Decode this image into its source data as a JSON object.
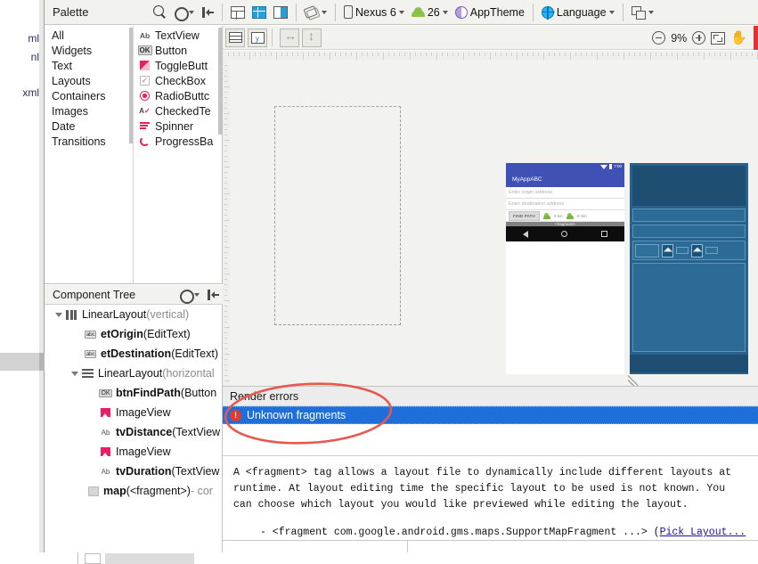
{
  "editor_tabs": [
    {
      "label": "ml"
    },
    {
      "label": "nl"
    },
    {
      "label": "xml"
    }
  ],
  "toolbar": {
    "palette_title": "Palette",
    "search_icon": "search-icon",
    "gear_icon": "gear-icon",
    "collapse_icon": "collapse-all-icon",
    "view_design_icon": "design-view-icon",
    "view_blueprint_icon": "blueprint-view-icon",
    "view_both_icon": "both-views-icon",
    "orientation_icon": "orientation-icon",
    "device_label": "Nexus 6",
    "api_label": "26",
    "theme_label": "AppTheme",
    "language_label": "Language",
    "layout_variant_icon": "layout-variants-icon"
  },
  "toolbar2": {
    "baseline_icon": "show-baselines-icon",
    "constraints_icon": "show-constraints-icon",
    "expand_horizontal_icon": "expand-horizontal-icon",
    "expand_vertical_icon": "expand-vertical-icon",
    "zoom_out_icon": "zoom-out-icon",
    "zoom_level": "9%",
    "zoom_in_icon": "zoom-in-icon",
    "zoom_fit_icon": "zoom-to-fit-icon",
    "pan_icon": "pan-hand-icon"
  },
  "palette": {
    "categories": [
      {
        "label": "All"
      },
      {
        "label": "Widgets"
      },
      {
        "label": "Text"
      },
      {
        "label": "Layouts"
      },
      {
        "label": "Containers"
      },
      {
        "label": "Images"
      },
      {
        "label": "Date"
      },
      {
        "label": "Transitions"
      }
    ],
    "items": [
      {
        "label": "TextView",
        "icon": "ab-text-icon"
      },
      {
        "label": "Button",
        "icon": "ok-button-icon"
      },
      {
        "label": "ToggleButt",
        "icon": "toggle-button-icon"
      },
      {
        "label": "CheckBox",
        "icon": "checkbox-icon"
      },
      {
        "label": "RadioButtc",
        "icon": "radio-button-icon"
      },
      {
        "label": "CheckedTe",
        "icon": "checked-textview-icon"
      },
      {
        "label": "Spinner",
        "icon": "spinner-icon"
      },
      {
        "label": "ProgressBa",
        "icon": "progressbar-icon"
      }
    ]
  },
  "component_tree": {
    "title": "Component Tree",
    "gear_icon": "gear-icon",
    "collapse_icon": "collapse-all-icon",
    "nodes": [
      {
        "icon": "linearlayout-vertical-icon",
        "name": "LinearLayout",
        "type": " (vertical)",
        "muted": true,
        "indent": 0,
        "expander": true
      },
      {
        "icon": "edittext-icon",
        "name": "etOrigin",
        "type": " (EditText)",
        "muted": false,
        "indent": 1,
        "expander": false
      },
      {
        "icon": "edittext-icon",
        "name": "etDestination",
        "type": " (EditText)",
        "muted": false,
        "indent": 1,
        "expander": false
      },
      {
        "icon": "linearlayout-horizontal-icon",
        "name": "LinearLayout",
        "type": " (horizontal",
        "muted": true,
        "indent": 1,
        "expander": true
      },
      {
        "icon": "button-icon",
        "name": "btnFindPath",
        "type": " (Button",
        "muted": false,
        "indent": 2,
        "expander": false
      },
      {
        "icon": "imageview-icon",
        "name": "ImageView",
        "type": "",
        "muted": false,
        "indent": 2,
        "expander": false,
        "plain": true
      },
      {
        "icon": "textview-icon",
        "name": "tvDistance",
        "type": " (TextView",
        "muted": false,
        "indent": 2,
        "expander": false
      },
      {
        "icon": "imageview-icon",
        "name": "ImageView",
        "type": "",
        "muted": false,
        "indent": 2,
        "expander": false,
        "plain": true
      },
      {
        "icon": "textview-icon",
        "name": "tvDuration",
        "type": " (TextView",
        "muted": false,
        "indent": 2,
        "expander": false
      },
      {
        "icon": "fragment-icon",
        "name": "map",
        "type": " (<fragment>)",
        "suffix": " - cor",
        "muted": false,
        "indent": 1,
        "expander": false
      }
    ]
  },
  "device_preview": {
    "status_time": "7:00",
    "app_title": "MyAppABC",
    "origin_placeholder": "Enter origin address",
    "destination_placeholder": "Enter destination address",
    "find_path_label": "FIND PATH",
    "distance_value": "0 km",
    "duration_value": "0 min",
    "map_label": "<fragment>",
    "nav_back_icon": "nav-back-icon",
    "nav_home_icon": "nav-home-icon",
    "nav_recents_icon": "nav-recents-icon"
  },
  "render_errors": {
    "header": "Render errors",
    "selected_error": "Unknown fragments",
    "error_icon": "error-icon",
    "description": "A <fragment> tag allows a layout file to dynamically include different layouts at runtime. At layout editing time the specific layout to be used is not known. You can choose which layout you would like previewed while editing the layout.",
    "bullet_prefix": "- <fragment com.google.android.gms.maps.SupportMapFragment ...> (",
    "bullet_link": "Pick Layout...",
    "selection_bg": "#1e6fd9",
    "error_red": "#e03b2f"
  },
  "annotation": {
    "shape": "red-ellipse-highlight",
    "color": "#e8584f"
  }
}
